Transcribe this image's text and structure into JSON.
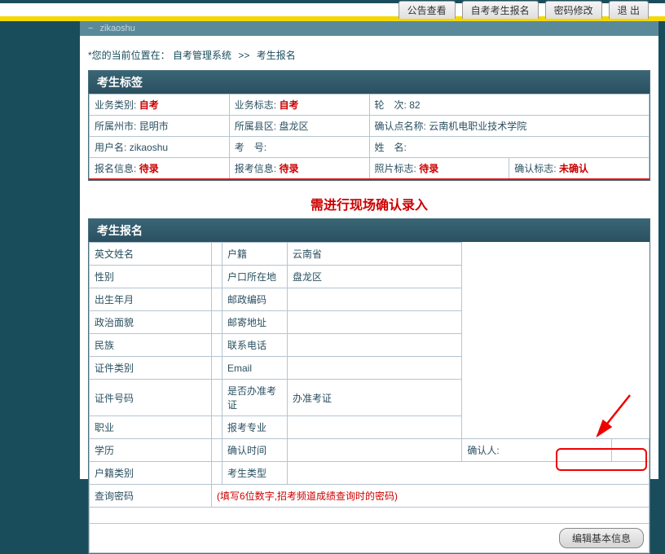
{
  "topNav": {
    "items": [
      "公告查看",
      "自考考生报名",
      "密码修改",
      "退 出"
    ]
  },
  "tabHeader": {
    "closeSymbol": "−",
    "username": "zikaoshu"
  },
  "breadcrumb": {
    "prefix": "*您的当前位置在：",
    "part1": "自考管理系统",
    "sep": ">>",
    "part2": "考生报名"
  },
  "tagPanel": {
    "title": "考生标签",
    "rows": [
      {
        "c1l": "业务类别:",
        "c1v": "自考",
        "c1red": true,
        "c2l": "业务标志:",
        "c2v": "自考",
        "c2red": true,
        "c3l": "轮　次:",
        "c3v": "82"
      },
      {
        "c1l": "所属州市:",
        "c1v": "昆明市",
        "c2l": "所属县区:",
        "c2v": "盘龙区",
        "c3l": "确认点名称:",
        "c3v": "云南机电职业技术学院"
      },
      {
        "c1l": "用户名:",
        "c1v": "zikaoshu",
        "c2l": "考　号:",
        "c2v": "",
        "c3l": "姓　名:",
        "c3v": ""
      },
      {
        "c1l": "报名信息:",
        "c1v": "待录",
        "c1red": true,
        "c2l": "报考信息:",
        "c2v": "待录",
        "c2red": true,
        "c3l": "照片标志:",
        "c3v": "待录",
        "c3red": true,
        "c4l": "确认标志:",
        "c4v": "未确认",
        "c4red": true
      }
    ]
  },
  "confirmNotice": "需进行现场确认录入",
  "formPanel": {
    "title": "考生报名",
    "rows": [
      {
        "l1": "英文姓名",
        "l2": "户籍",
        "v2": "云南省"
      },
      {
        "l1": "性别",
        "l2": "户口所在地",
        "v2": "盘龙区"
      },
      {
        "l1": "出生年月",
        "l2": "邮政编码"
      },
      {
        "l1": "政治面貌",
        "l2": "邮寄地址"
      },
      {
        "l1": "民族",
        "l2": "联系电话"
      },
      {
        "l1": "证件类别",
        "l2": "Email"
      },
      {
        "l1": "证件号码",
        "l2": "是否办准考证",
        "v2": "办准考证"
      },
      {
        "l1": "职业",
        "l2": "报考专业"
      },
      {
        "l1": "学历",
        "l2": "确认时间",
        "l3": "确认人:"
      },
      {
        "l1": "户籍类别",
        "l2": "考生类型"
      },
      {
        "l1": "查询密码",
        "hint": "(填写6位数字,招考频道成绩查询时的密码)"
      }
    ],
    "editButton": "编辑基本信息"
  }
}
